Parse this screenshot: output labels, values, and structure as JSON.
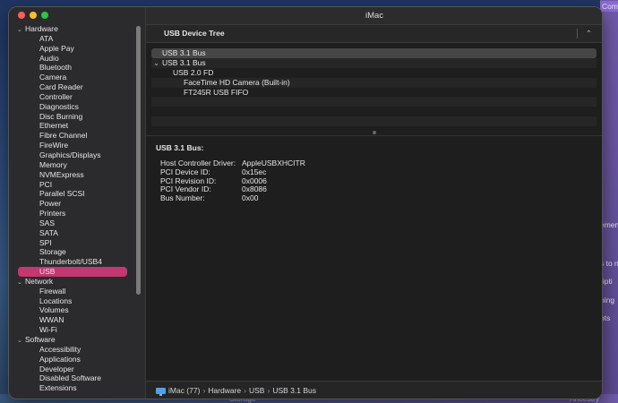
{
  "window": {
    "title": "iMac"
  },
  "background_fragments": {
    "right": [
      "Com",
      "ement",
      "s to n",
      "ripti",
      "ping",
      "ots"
    ],
    "bottom": [
      "Storage",
      "Ancestry"
    ]
  },
  "sidebar": {
    "sections": [
      {
        "label": "Hardware",
        "items": [
          "ATA",
          "Apple Pay",
          "Audio",
          "Bluetooth",
          "Camera",
          "Card Reader",
          "Controller",
          "Diagnostics",
          "Disc Burning",
          "Ethernet",
          "Fibre Channel",
          "FireWire",
          "Graphics/Displays",
          "Memory",
          "NVMExpress",
          "PCI",
          "Parallel SCSI",
          "Power",
          "Printers",
          "SAS",
          "SATA",
          "SPI",
          "Storage",
          "Thunderbolt/USB4",
          "USB"
        ]
      },
      {
        "label": "Network",
        "items": [
          "Firewall",
          "Locations",
          "Volumes",
          "WWAN",
          "Wi-Fi"
        ]
      },
      {
        "label": "Software",
        "items": [
          "Accessibility",
          "Applications",
          "Developer",
          "Disabled Software",
          "Extensions"
        ]
      }
    ],
    "selected": "USB"
  },
  "usb_tree": {
    "header": "USB Device Tree",
    "rows": [
      {
        "label": "USB 3.1 Bus",
        "indent": 0,
        "chevron": "",
        "selected": true
      },
      {
        "label": "USB 3.1 Bus",
        "indent": 0,
        "chevron": "⌄",
        "selected": false
      },
      {
        "label": "USB 2.0 FD",
        "indent": 1,
        "chevron": "",
        "selected": false
      },
      {
        "label": "FaceTime HD Camera (Built-in)",
        "indent": 2,
        "chevron": "",
        "selected": false
      },
      {
        "label": "FT245R USB FIFO",
        "indent": 2,
        "chevron": "",
        "selected": false
      }
    ]
  },
  "detail": {
    "title": "USB 3.1 Bus:",
    "properties": [
      {
        "key": "Host Controller Driver:",
        "value": "AppleUSBXHCITR"
      },
      {
        "key": "PCI Device ID:",
        "value": "0x15ec"
      },
      {
        "key": "PCI Revision ID:",
        "value": "0x0006"
      },
      {
        "key": "PCI Vendor ID:",
        "value": "0x8086"
      },
      {
        "key": "Bus Number:",
        "value": "0x00"
      }
    ]
  },
  "breadcrumb": [
    "iMac (77)",
    "Hardware",
    "USB",
    "USB 3.1 Bus"
  ],
  "colors": {
    "selection": "#c2386f",
    "sidebar_bg": "#2b2b2d",
    "main_bg": "#1e1e1e"
  }
}
